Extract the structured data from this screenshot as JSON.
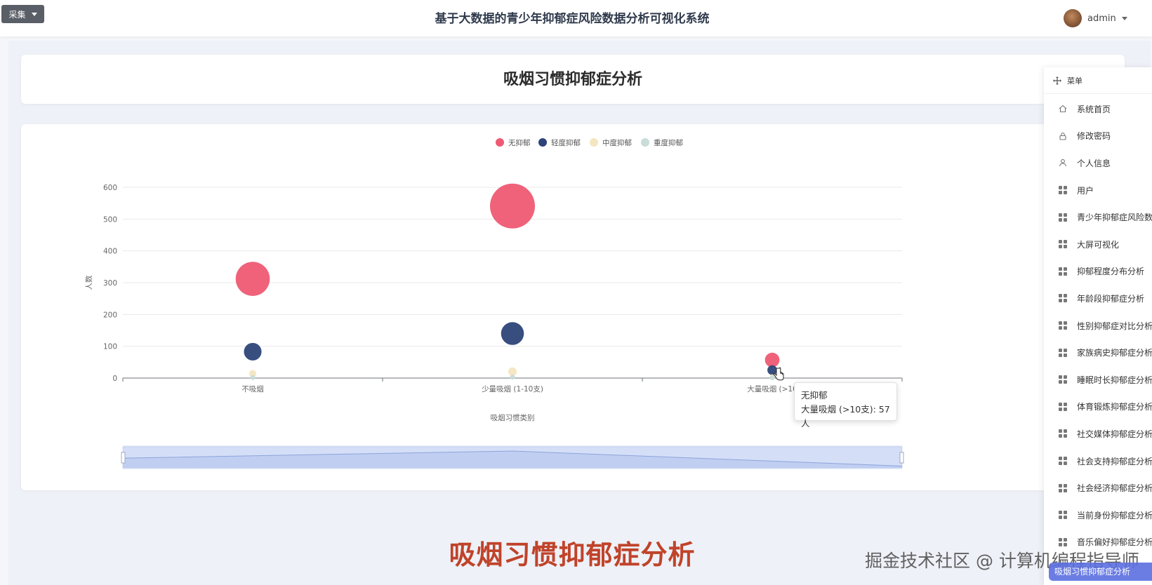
{
  "header": {
    "collect_label": "采集",
    "title": "基于大数据的青少年抑郁症风险数据分析可视化系统",
    "username": "admin"
  },
  "page": {
    "title": "吸烟习惯抑郁症分析"
  },
  "chart_data": {
    "type": "scatter",
    "title": "",
    "xlabel": "吸烟习惯类别",
    "ylabel": "人数",
    "categories": [
      "不吸烟",
      "少量吸烟 (1-10支)",
      "大量吸烟 (>10支)"
    ],
    "x_tick_labels": [
      "不吸烟",
      "少量吸烟 (1-10支)",
      "大量吸烟 (>10"
    ],
    "ylim": [
      0,
      600
    ],
    "yticks": [
      0,
      100,
      200,
      300,
      400,
      500,
      600
    ],
    "grid": true,
    "legend_position": "top",
    "series": [
      {
        "name": "无抑郁",
        "color": "#ee5a73",
        "values": [
          312,
          541,
          57
        ]
      },
      {
        "name": "轻度抑郁",
        "color": "#2d4478",
        "values": [
          83,
          140,
          25
        ]
      },
      {
        "name": "中度抑郁",
        "color": "#f4e6c0",
        "values": [
          14,
          20,
          4
        ]
      },
      {
        "name": "重度抑郁",
        "color": "#c9dcd8",
        "values": [
          2,
          3,
          1
        ]
      }
    ]
  },
  "tooltip": {
    "series": "无抑郁",
    "text": "大量吸烟 (>10支): 57人"
  },
  "menu": {
    "header": "菜单",
    "items": [
      {
        "label": "系统首页",
        "icon": "home-icon"
      },
      {
        "label": "修改密码",
        "icon": "lock-icon"
      },
      {
        "label": "个人信息",
        "icon": "user-icon"
      },
      {
        "label": "用户",
        "icon": "grid-icon"
      },
      {
        "label": "青少年抑郁症风险数",
        "icon": "grid-icon"
      },
      {
        "label": "大屏可视化",
        "icon": "grid-icon"
      },
      {
        "label": "抑郁程度分布分析",
        "icon": "grid-icon"
      },
      {
        "label": "年龄段抑郁症分析",
        "icon": "grid-icon"
      },
      {
        "label": "性别抑郁症对比分析",
        "icon": "grid-icon"
      },
      {
        "label": "家族病史抑郁症分析",
        "icon": "grid-icon"
      },
      {
        "label": "睡眠时长抑郁症分析",
        "icon": "grid-icon"
      },
      {
        "label": "体育锻炼抑郁症分析",
        "icon": "grid-icon"
      },
      {
        "label": "社交媒体抑郁症分析",
        "icon": "grid-icon"
      },
      {
        "label": "社会支持抑郁症分析",
        "icon": "grid-icon"
      },
      {
        "label": "社会经济抑郁症分析",
        "icon": "grid-icon"
      },
      {
        "label": "当前身份抑郁症分析",
        "icon": "grid-icon"
      },
      {
        "label": "音乐偏好抑郁症分析",
        "icon": "grid-icon"
      }
    ]
  },
  "footer": {
    "big_title": "吸烟习惯抑郁症分析",
    "watermark": "掘金技术社区 @ 计算机编程指导师",
    "badge": "吸烟习惯抑郁症分析"
  }
}
